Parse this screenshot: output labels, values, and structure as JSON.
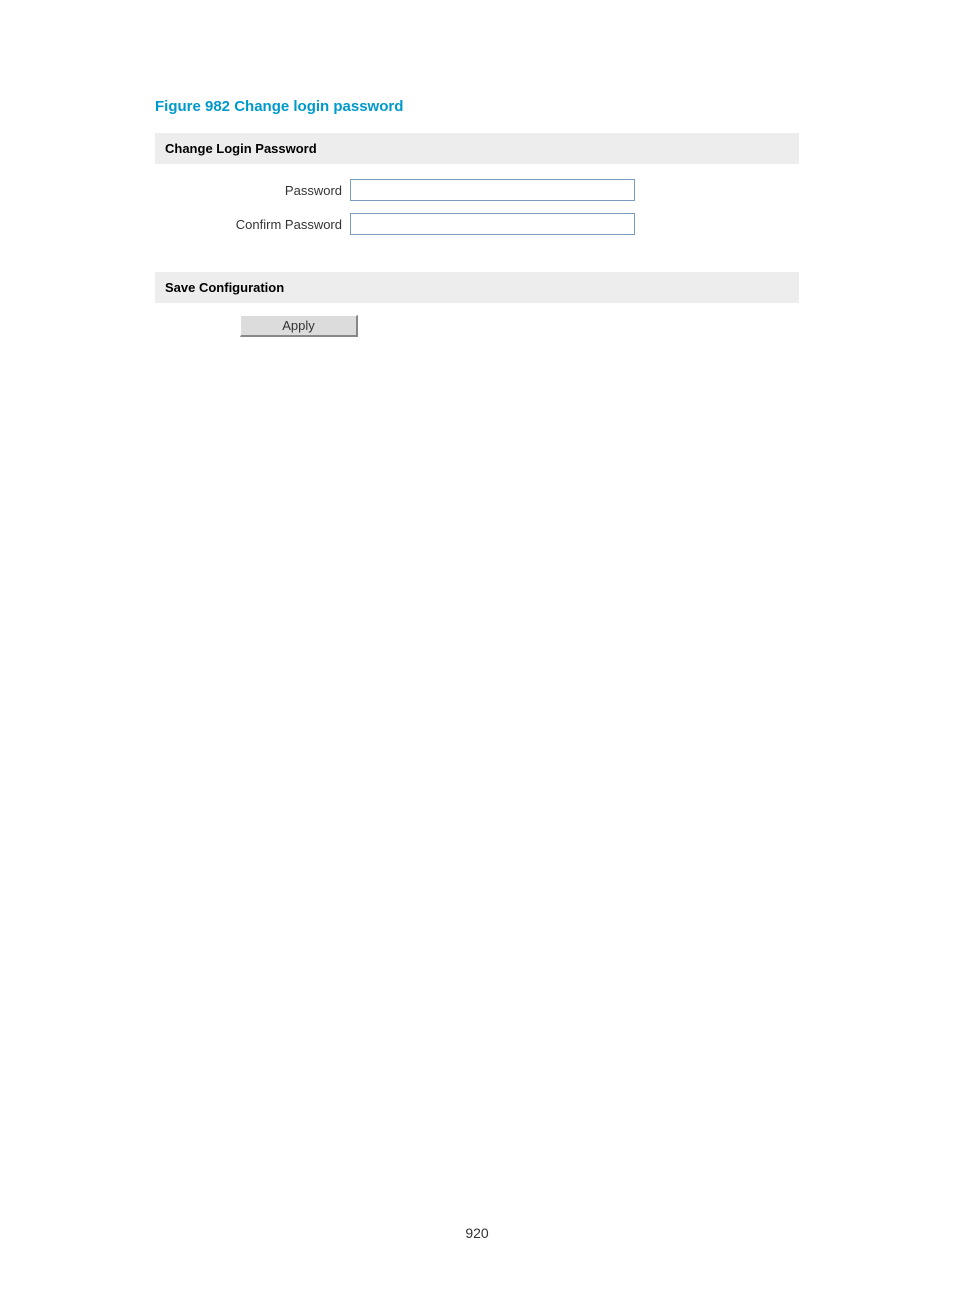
{
  "figure_caption": "Figure 982 Change login password",
  "sections": {
    "change_password": {
      "header": "Change Login Password",
      "password_label": "Password",
      "confirm_password_label": "Confirm Password",
      "password_value": "",
      "confirm_password_value": ""
    },
    "save_config": {
      "header": "Save Configuration",
      "apply_button": "Apply"
    }
  },
  "page_number": "920"
}
